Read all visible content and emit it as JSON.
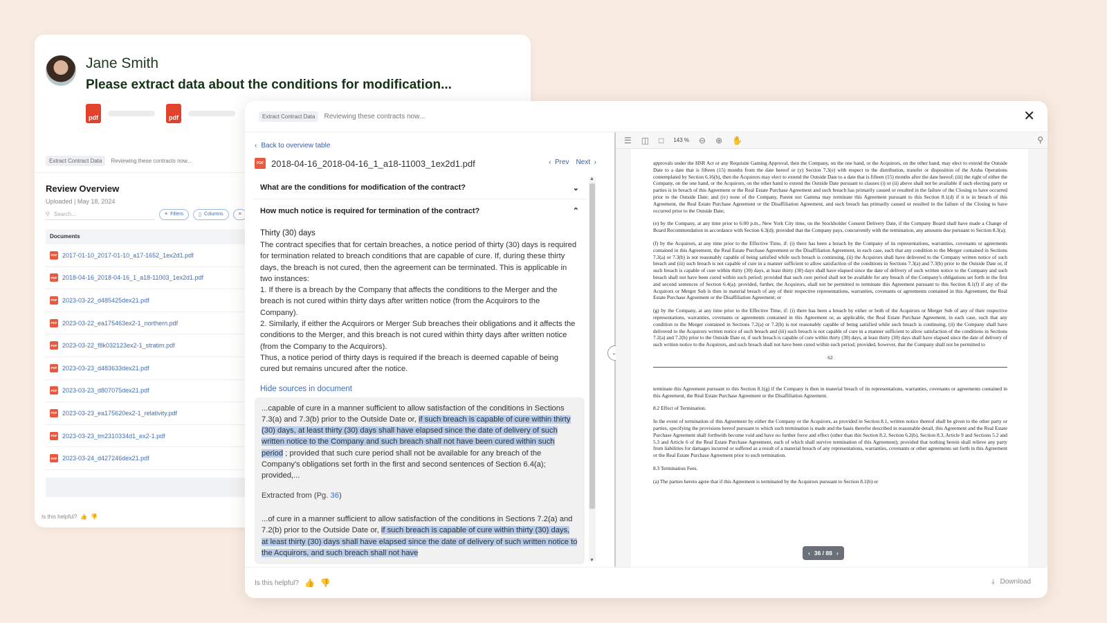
{
  "back_card": {
    "user_name": "Jane Smith",
    "prompt": "Please extract data about the conditions for modification...",
    "attachment_label": "pdf",
    "tag": "Extract Contract Data",
    "status": "Reviewing these contracts now...",
    "review_title": "Review Overview",
    "review_sub": "Uploaded | May 18, 2024",
    "search_placeholder": "Search...",
    "filters_label": "Filters",
    "columns_label": "Columns",
    "documents_header": "Documents",
    "documents": [
      "2017-01-10_2017-01-10_a17-1652_1ex2d1.pdf",
      "2018-04-16_2018-04-16_1_a18-11003_1ex2d1.pdf",
      "2023-03-22_d485425dex21.pdf",
      "2023-03-22_ea175463ex2-1_northern.pdf",
      "2023-03-22_f8k032123ex2-1_stratim.pdf",
      "2023-03-23_d483633dex21.pdf",
      "2023-03-23_d807075dex21.pdf",
      "2023-03-23_ea175620ex2-1_relativity.pdf",
      "2023-03-23_tm2310334d1_ex2-1.pdf",
      "2023-03-24_d427246dex21.pdf"
    ],
    "helpful_label": "Is this helpful?"
  },
  "modal": {
    "tag": "Extract Contract Data",
    "status": "Reviewing these contracts now...",
    "close_icon": "close-icon",
    "back_link": "Back to overview table",
    "file_icon_label": "PDF",
    "file_name": "2018-04-16_2018-04-16_1_a18-11003_1ex2d1.pdf",
    "prev_label": "Prev",
    "next_label": "Next",
    "question_1": "What are the conditions for modification of the contract?",
    "question_2": "How much notice is required for termination of the contract?",
    "answer_title": "Thirty (30) days",
    "answer_body": "The contract specifies that for certain breaches, a notice period of thirty (30) days is required for termination related to breach conditions that are capable of cure. If, during these thirty days, the breach is not cured, then the agreement can be terminated. This is applicable in two instances:\n1. If there is a breach by the Company that affects the conditions to the Merger and the breach is not cured within thirty days after written notice (from the Acquirors to the Company).\n2. Similarly, if either the Acquirors or Merger Sub breaches their obligations and it affects the conditions to the Merger, and this breach is not cured within thirty days after written notice (from the Company to the Acquirors).\nThus, a notice period of thirty days is required if the breach is deemed capable of being cured but remains uncured after the notice.",
    "hide_sources": "Hide sources in document",
    "source_1_pre": "...capable of cure in a manner sufficient to allow satisfaction of the conditions in Sections 7.3(a) and 7.3(b) prior to the Outside Date or, ",
    "source_1_hl": "if such breach is capable of cure within thirty (30) days, at least thirty (30) days shall have elapsed since the date of delivery of such written notice to the Company and such breach shall not have been cured within such period",
    "source_1_post": " ; provided that such cure period shall not be available for any breach of the Company's obligations set forth in the first and second sentences of Section 6.4(a); provided,...",
    "extracted_label": "Extracted from (Pg. ",
    "extracted_page": "36",
    "extracted_close": ")",
    "source_2_pre": "...of cure in a manner sufficient to allow satisfaction of the conditions in Sections 7.2(a) and 7.2(b) prior to the Outside Date or, ",
    "source_2_hl": "if such breach is capable of cure within thirty (30) days, at least thirty (30) days shall have elapsed since the date of delivery of such written notice to the Acquirors, and such breach shall not have",
    "zoom": "143 %",
    "page_number": "62",
    "page_indicator": "36 / 88",
    "pdf_paragraphs": [
      "approvals under the HSR Act or any Requisite Gaming Approval, then the Company, on the one hand, or the Acquirors, on the other hand, may elect to extend the Outside Date to a date that is fifteen (15) months from the date hereof or (y) Section 7.3(e) with respect to the distribution, transfer or disposition of the Aruba Operations contemplated by Section 6.16(b), then the Acquirors may elect to extend the Outside Date to a date that is fifteen (15) months after the date hereof; (iii) the right of either the Company, on the one hand, or the Acquirors, on the other hand to extend the Outside Date pursuant to clauses (i) or (ii) above shall not be available if such electing party or parties is in breach of this Agreement or the Real Estate Purchase Agreement and such breach has primarily caused or resulted in the failure of the Closing to have occurred prior to the Outside Date; and (iv) none of the Company, Parent nor Gamma may terminate this Agreement pursuant to this Section 8.1(d) if it is in breach of this Agreement, the Real Estate Purchase Agreement or the Disaffiliation Agreement, and such breach has primarily caused or resulted in the failure of the Closing to have occurred prior to the Outside Date;",
      "(e)   by the Company, at any time prior to 6:00 p.m., New York City time, on the Stockholder Consent Delivery Date, if the Company Board shall have made a Change of Board Recommendation in accordance with Section 6.3(d); provided that the Company pays, concurrently with the termination, any amounts due pursuant to Section 8.3(a);",
      "(f)   by the Acquirors, at any time prior to the Effective Time, if: (i) there has been a breach by the Company of its representations, warranties, covenants or agreements contained in this Agreement, the Real Estate Purchase Agreement or the Disaffiliation Agreement, in each case, such that any condition to the Merger contained in Sections 7.3(a) or 7.3(b) is not reasonably capable of being satisfied while such breach is continuing, (ii) the Acquirors shall have delivered to the Company written notice of such breach and (iii) such breach is not capable of cure in a manner sufficient to allow satisfaction of the conditions in Sections 7.3(a) and 7.3(b) prior to the Outside Date or, if such breach is capable of cure within thirty (30) days, at least thirty (30) days shall have elapsed since the date of delivery of such written notice to the Company and such breach shall not have been cured within such period; provided that such cure period shall not be available for any breach of the Company's obligations set forth in the first and second sentences of Section 6.4(a); provided, further, the Acquirors, shall not be permitted to terminate this Agreement pursuant to this Section 8.1(f) if any of the Acquirors or Merger Sub is then in material breach of any of their respective representations, warranties, covenants or agreements contained in this Agreement, the Real Estate Purchase Agreement or the Disaffiliation Agreement; or",
      "(g)   by the Company, at any time prior to the Effective Time, if: (i) there has been a breach by either or both of the Acquirors or Merger Sub of any of their respective representations, warranties, covenants or agreements contained in this Agreement or, as applicable, the Real Estate Purchase Agreement, in each case, such that any condition to the Merger contained in Sections 7.2(a) or 7.2(b) is not reasonably capable of being satisfied while such breach is continuing, (ii) the Company shall have delivered to the Acquirors written notice of such breach and (iii) such breach is not capable of cure in a manner sufficient to allow satisfaction of the conditions in Sections 7.2(a) and 7.2(b) prior to the Outside Date or, if such breach is capable of cure within thirty (30) days, at least thirty (30) days shall have elapsed since the date of delivery of such written notice to the Acquirors, and such breach shall not have been cured within such period; provided, however, that the Company shall not be permitted to"
    ],
    "pdf_paragraphs_2": [
      "terminate this Agreement pursuant to this Section 8.1(g) if the Company is then in material breach of its representations, warranties, covenants or agreements contained in this Agreement, the Real Estate Purchase Agreement or the Disaffiliation Agreement.",
      "8.2        Effect of Termination.",
      "In the event of termination of this Agreement by either the Company or the Acquirors, as provided in Section 8.1, written notice thereof shall be given to the other party or parties, specifying the provisions hereof pursuant to which such termination is made and the basis therefor described in reasonable detail, this Agreement and the Real Estate Purchase Agreement shall forthwith become void and have no further force and effect (other than this Section 8.2, Section 6.2(b), Section 8.3, Article 9 and Sections 5.2 and 5.3 and Article 6 of the Real Estate Purchase Agreement, each of which shall survive termination of this Agreement); provided that nothing herein shall relieve any party from liabilities for damages incurred or suffered as a result of a material breach of any representations, warranties, covenants or other agreements set forth in this Agreement or the Real Estate Purchase Agreement prior to such termination.",
      "8.3        Termination Fees.",
      "(a)        The parties hereto agree that if this Agreement is terminated by the Acquirors pursuant to Section 8.1(b) or"
    ],
    "helpful_label": "Is this helpful?",
    "download_label": "Download"
  }
}
